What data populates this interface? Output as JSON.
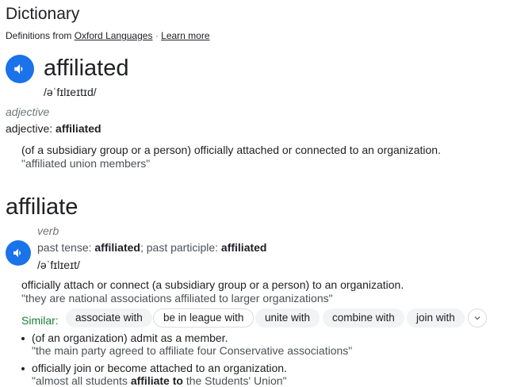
{
  "header": {
    "title": "Dictionary",
    "source_prefix": "Definitions from",
    "source_link": "Oxford Languages",
    "separator": "·",
    "learn_more": "Learn more"
  },
  "entry1": {
    "headword": "affiliated",
    "pronunciation": "/əˈfɪlɪeɪtɪd/",
    "pos": "adjective",
    "form_label": "adjective:",
    "form_value": "affiliated",
    "definition": "(of a subsidiary group or a person) officially attached or connected to an organization.",
    "example": "\"affiliated union members\""
  },
  "entry2": {
    "headword": "affiliate",
    "pos": "verb",
    "forms": {
      "past_tense_label": "past tense:",
      "past_tense_value": "affiliated",
      "sep": ";",
      "past_participle_label": "past participle:",
      "past_participle_value": "affiliated"
    },
    "pronunciation": "/əˈfɪlɪeɪt/",
    "definition": "officially attach or connect (a subsidiary group or a person) to an organization.",
    "example": "\"they are national associations affiliated to larger organizations\"",
    "similar_label": "Similar:",
    "similar": [
      "associate with",
      "be in league with",
      "unite with",
      "combine with",
      "join with"
    ],
    "senses": [
      {
        "definition": "(of an organization) admit as a member.",
        "example": "\"the main party agreed to affiliate four Conservative associations\""
      },
      {
        "definition": "officially join or become attached to an organization.",
        "example_pre": "\"almost all students ",
        "example_bold": "affiliate to",
        "example_post": " the Students' Union\""
      }
    ]
  },
  "colors": {
    "accent": "#1a73e8",
    "similar_green": "#188038",
    "chip_bg": "#f1f3f4"
  }
}
